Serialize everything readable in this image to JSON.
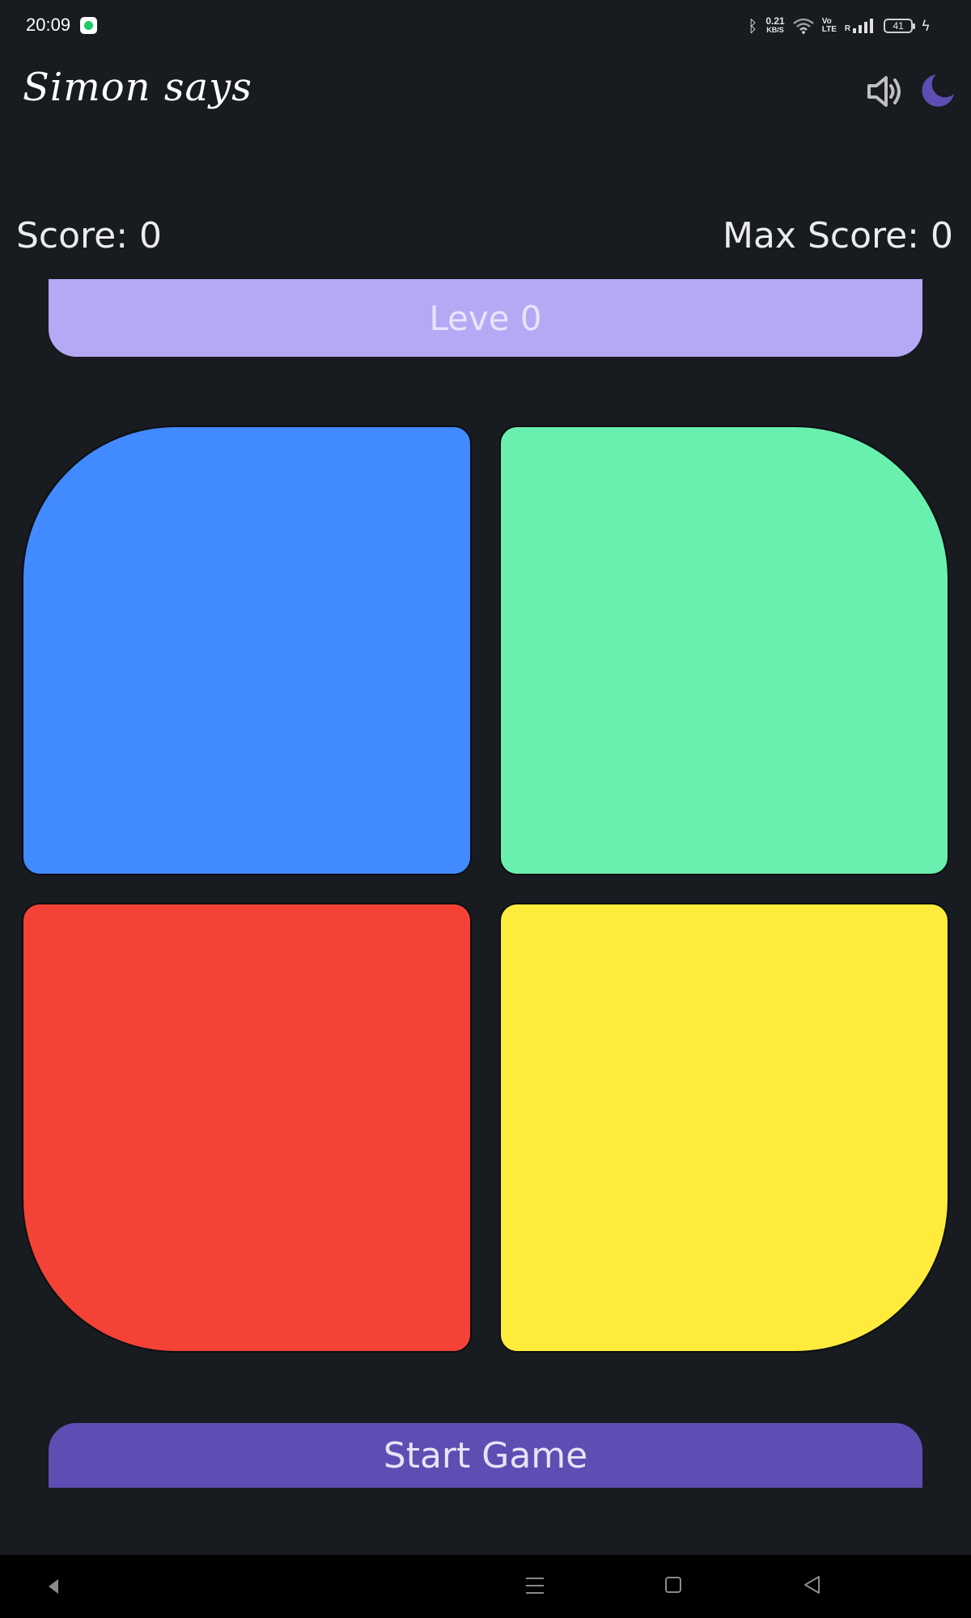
{
  "status_bar": {
    "time": "20:09",
    "net_speed_value": "0.21",
    "net_speed_unit": "KB/S",
    "volte_top": "Vo",
    "volte_bottom": "LTE",
    "roaming": "R",
    "battery": "41"
  },
  "app_bar": {
    "title": "Simon says",
    "sound_icon": "volume-icon",
    "theme_icon": "moon-icon",
    "accent_color": "#5e4db2"
  },
  "scores": {
    "score": "Score: 0",
    "max_score": "Max Score: 0"
  },
  "level": {
    "label": "Leve 0"
  },
  "pads": [
    {
      "name": "blue",
      "color": "#428aff"
    },
    {
      "name": "green",
      "color": "#69f0ae"
    },
    {
      "name": "red",
      "color": "#f44336"
    },
    {
      "name": "yellow",
      "color": "#ffeb3b"
    }
  ],
  "start_button": {
    "label": "Start Game"
  }
}
